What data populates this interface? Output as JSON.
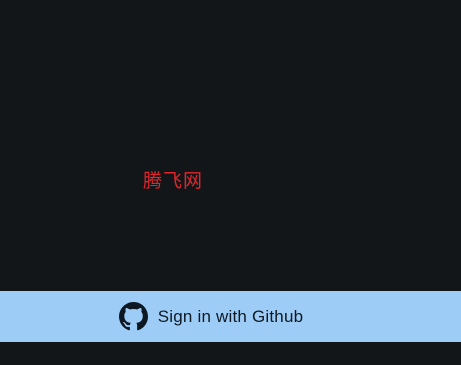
{
  "site": {
    "name": "腾飞网"
  },
  "auth": {
    "github_button_label": "Sign in with Github",
    "github_icon": "github-icon"
  },
  "colors": {
    "background": "#131619",
    "site_name": "#e0262b",
    "button_background": "#9dcdf7",
    "button_text": "#0d1822"
  }
}
